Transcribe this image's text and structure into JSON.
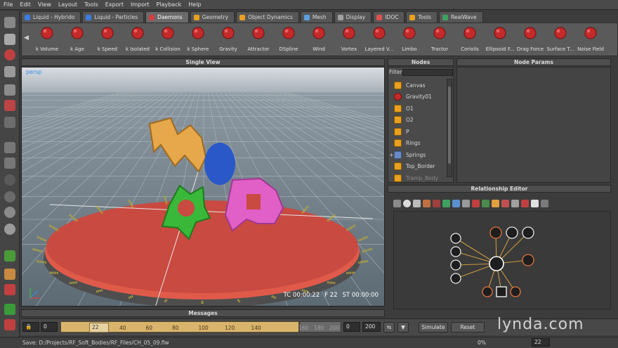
{
  "menu": [
    "File",
    "Edit",
    "View",
    "Layout",
    "Tools",
    "Export",
    "Import",
    "Playback",
    "Help"
  ],
  "tabs": [
    {
      "label": "Liquid - Hybrido",
      "color": "#3b7de0"
    },
    {
      "label": "Liquid - Particles",
      "color": "#3b7de0"
    },
    {
      "label": "Daemons",
      "color": "#d04040"
    },
    {
      "label": "Geometry",
      "color": "#e8a020"
    },
    {
      "label": "Object Dynamics",
      "color": "#e8a020"
    },
    {
      "label": "Mesh",
      "color": "#5aa0e0"
    },
    {
      "label": "Display",
      "color": "#a0a0a0"
    },
    {
      "label": "IDOC",
      "color": "#e05050"
    },
    {
      "label": "Tools",
      "color": "#e8a020"
    },
    {
      "label": "RealWave",
      "color": "#40a060"
    }
  ],
  "active_tab": "Daemons",
  "tools": [
    "k Volume",
    "k Age",
    "k Speed",
    "k Isolated",
    "k Collision",
    "k Sphere",
    "Gravity",
    "Attractor",
    "DSpline",
    "Wind",
    "Vortex",
    "Layered V...",
    "Limbo",
    "Tractor",
    "Coriolis",
    "Ellipsoid F...",
    "Drag Force",
    "Surface T...",
    "Noise Field"
  ],
  "panels": {
    "single_view": "Single View",
    "nodes": "Nodes",
    "node_params": "Node Params",
    "relationship_editor": "Relationship Editor",
    "messages": "Messages"
  },
  "viewport": {
    "camera": "persp",
    "timecode": "TC 00:00:22",
    "frame": "F 22",
    "sim_time": "ST 00:00:00"
  },
  "nodes_filter_label": "Filter",
  "nodes": [
    {
      "name": "Canvas",
      "expandable": false,
      "dim": false
    },
    {
      "name": "Gravity01",
      "expandable": false,
      "dim": false
    },
    {
      "name": "O1",
      "expandable": false,
      "dim": false
    },
    {
      "name": "O2",
      "expandable": false,
      "dim": false
    },
    {
      "name": "P",
      "expandable": false,
      "dim": false
    },
    {
      "name": "Rings",
      "expandable": false,
      "dim": false
    },
    {
      "name": "Springs",
      "expandable": true,
      "dim": false
    },
    {
      "name": "Top_Border",
      "expandable": false,
      "dim": false
    },
    {
      "name": "Tramp_Body",
      "expandable": false,
      "dim": true
    }
  ],
  "timeline": {
    "start": "0",
    "current": "22",
    "ticks": [
      "40",
      "60",
      "80",
      "100",
      "120",
      "140"
    ],
    "ticks_dim": [
      "160",
      "180",
      "200"
    ],
    "range_start": "0",
    "range_end": "200",
    "simulate_label": "Simulate",
    "reset_label": "Reset"
  },
  "status": {
    "path": "Save: D:/Projects/RF_Soft_Bodies/RF_Files/CH_05_09.flw",
    "percent": "0%",
    "frame": "22"
  },
  "watermark": "lynda.com"
}
